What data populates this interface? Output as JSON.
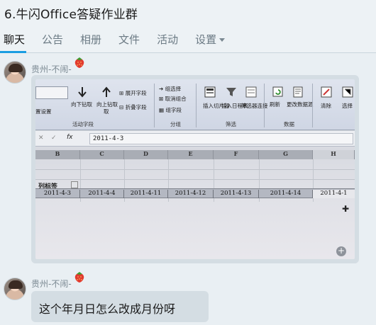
{
  "header": {
    "title": "6.牛闪Office答疑作业群",
    "tabs": [
      {
        "label": "聊天",
        "active": true
      },
      {
        "label": "公告",
        "active": false
      },
      {
        "label": "相册",
        "active": false
      },
      {
        "label": "文件",
        "active": false
      },
      {
        "label": "活动",
        "active": false
      },
      {
        "label": "设置",
        "active": false,
        "has_dropdown": true
      }
    ]
  },
  "messages": [
    {
      "sender": "贵州-不闹-",
      "badge_icon": "strawberry-icon",
      "type": "image",
      "image": {
        "ribbon": {
          "buttons": [
            "向下钻取",
            "向上钻取",
            "展开字段",
            "折叠字段",
            "组选择",
            "取消组合",
            "组字段",
            "插入切片器",
            "插入日程表",
            "筛选器连接",
            "刷新",
            "更改数据源",
            "清除",
            "选择"
          ],
          "groups": [
            "活动字段",
            "分组",
            "筛选",
            "数据"
          ],
          "fragments": [
            "置设置",
            "取"
          ]
        },
        "formula_bar": {
          "fx": "fx",
          "value": "2011-4-3"
        },
        "column_headers": [
          "B",
          "C",
          "D",
          "E",
          "F",
          "G",
          "H"
        ],
        "column_label_header": "列标签",
        "date_row": [
          "2011-4-3",
          "2011-4-4",
          "2011-4-11",
          "2011-4-12",
          "2011-4-13",
          "2011-4-14",
          "2011-4-1"
        ]
      }
    },
    {
      "sender": "贵州-不闹-",
      "badge_icon": "strawberry-icon",
      "type": "text",
      "text": "这个年月日怎么改成月份呀"
    }
  ],
  "colors": {
    "accent": "#1a9de1",
    "background": "#e9eff3",
    "bubble": "#d4dde3"
  }
}
